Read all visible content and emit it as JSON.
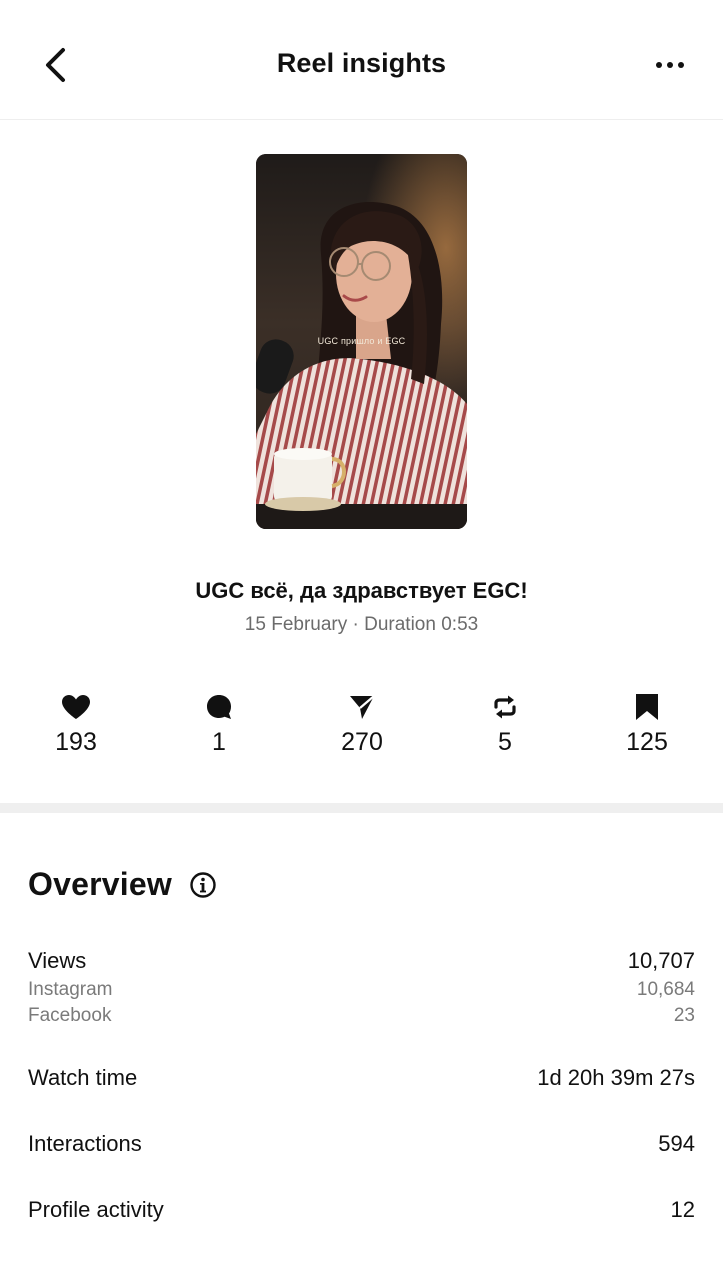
{
  "header": {
    "title": "Reel insights",
    "back_icon": "chevron-left-icon",
    "more_icon": "more-horizontal-icon"
  },
  "reel": {
    "thumbnail_caption": "UGC пришло и EGC",
    "title": "UGC всё, да здравствует EGC!",
    "meta": "15 February · Duration 0:53"
  },
  "stats": {
    "likes": "193",
    "comments": "1",
    "shares": "270",
    "reposts": "5",
    "saves": "125"
  },
  "overview": {
    "title": "Overview",
    "views_label": "Views",
    "views_value": "10,707",
    "instagram_label": "Instagram",
    "instagram_value": "10,684",
    "facebook_label": "Facebook",
    "facebook_value": "23",
    "watch_time_label": "Watch time",
    "watch_time_value": "1d 20h 39m 27s",
    "interactions_label": "Interactions",
    "interactions_value": "594",
    "profile_activity_label": "Profile activity",
    "profile_activity_value": "12"
  }
}
